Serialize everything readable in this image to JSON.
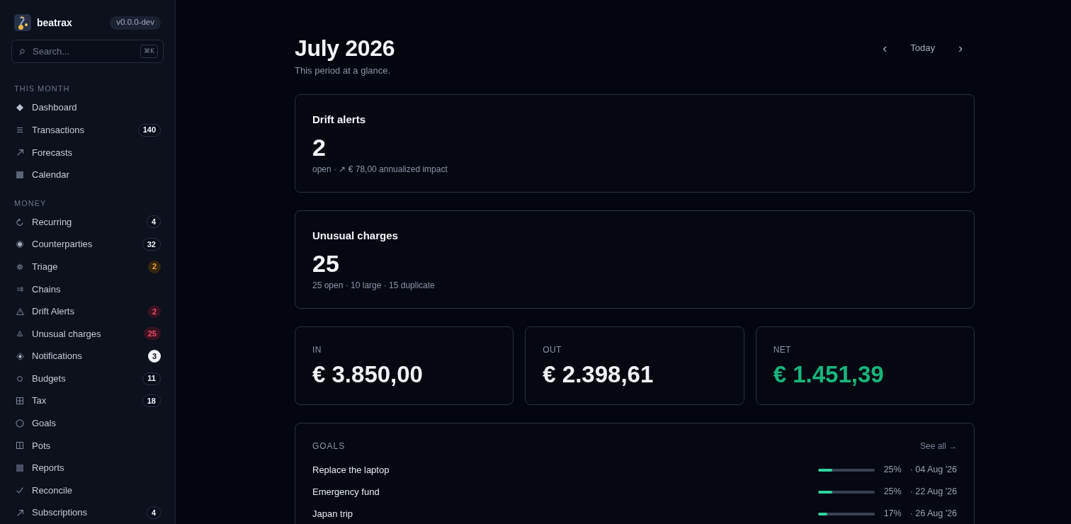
{
  "sidebar": {
    "brand": "beatrax",
    "version": "v0.0.0-dev",
    "search": {
      "placeholder": "Search...",
      "shortcut": "⌘K"
    },
    "sections": [
      {
        "title": "THIS MONTH",
        "items": [
          {
            "label": "Dashboard"
          },
          {
            "label": "Transactions",
            "badge": {
              "text": "140",
              "kind": "default"
            }
          },
          {
            "label": "Forecasts"
          },
          {
            "label": "Calendar"
          }
        ]
      },
      {
        "title": "MONEY",
        "items": [
          {
            "label": "Recurring",
            "badge": {
              "text": "4",
              "kind": "default"
            }
          },
          {
            "label": "Counterparties",
            "badge": {
              "text": "32",
              "kind": "default"
            }
          },
          {
            "label": "Triage",
            "badge": {
              "text": "2",
              "kind": "warning"
            }
          },
          {
            "label": "Chains"
          },
          {
            "label": "Drift Alerts",
            "badge": {
              "text": "2",
              "kind": "danger"
            }
          },
          {
            "label": "Unusual charges",
            "badge": {
              "text": "25",
              "kind": "danger"
            }
          },
          {
            "label": "Notifications",
            "badge": {
              "text": "3",
              "kind": "highlight"
            }
          },
          {
            "label": "Budgets",
            "badge": {
              "text": "11",
              "kind": "default"
            }
          },
          {
            "label": "Tax",
            "badge": {
              "text": "18",
              "kind": "default"
            }
          },
          {
            "label": "Goals"
          },
          {
            "label": "Pots"
          },
          {
            "label": "Reports"
          },
          {
            "label": "Reconcile"
          },
          {
            "label": "Subscriptions",
            "badge": {
              "text": "4",
              "kind": "default"
            }
          }
        ]
      }
    ]
  },
  "header": {
    "title": "July 2026",
    "subtitle": "This period at a glance.",
    "nav": {
      "prev": "‹",
      "today": "Today",
      "next": "›"
    }
  },
  "alert_cards": [
    {
      "title": "Drift alerts",
      "count": "2",
      "detail": "open · ↗ € 78,00 annualized impact"
    },
    {
      "title": "Unusual charges",
      "count": "25",
      "detail": "25 open · 10 large · 15 duplicate"
    }
  ],
  "totals": [
    {
      "label": "IN",
      "value": "€ 3.850,00",
      "kind": "neutral"
    },
    {
      "label": "OUT",
      "value": "€ 2.398,61",
      "kind": "neutral"
    },
    {
      "label": "NET",
      "value": "€ 1.451,39",
      "kind": "positive"
    }
  ],
  "goals": {
    "title": "GOALS",
    "link": "See all →",
    "rows": [
      {
        "name": "Replace the laptop",
        "level": 0.25,
        "percent": "25%",
        "due": "· 04 Aug '26"
      },
      {
        "name": "Emergency fund",
        "level": 0.25,
        "percent": "25%",
        "due": "· 22 Aug '26"
      },
      {
        "name": "Japan trip",
        "level": 0.17,
        "percent": "17%",
        "due": "· 26 Aug '26"
      }
    ]
  }
}
